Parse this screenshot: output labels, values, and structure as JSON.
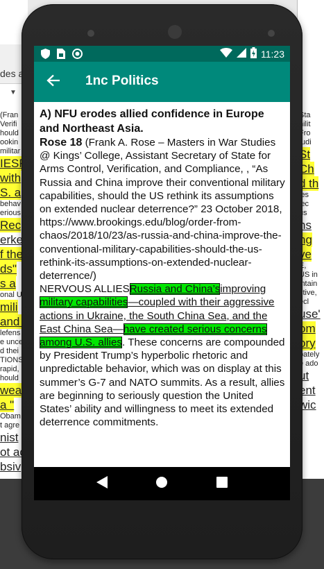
{
  "background_doc": {
    "left_lines": [
      {
        "text": "(Fran",
        "style": "small"
      },
      {
        "text": "Verifi",
        "style": "small"
      },
      {
        "text": "hould",
        "style": "small"
      },
      {
        "text": "ookin",
        "style": "small"
      },
      {
        "text": "militar",
        "style": "small"
      },
      {
        "text": "IESRu",
        "style": "big-hl"
      },
      {
        "text": "with",
        "style": "big-hl"
      },
      {
        "text": "S. a",
        "style": "big-hl"
      },
      {
        "text": "behav",
        "style": "small"
      },
      {
        "text": "erious",
        "style": "small"
      },
      {
        "text": "Rec",
        "style": "big-hl"
      },
      {
        "text": "erke",
        "style": "big"
      },
      {
        "text": "f the",
        "style": "big-hl"
      },
      {
        "text": "ds\"",
        "style": "big-hl"
      },
      {
        "text": "s a",
        "style": "big-hl"
      },
      {
        "text": "onal U",
        "style": "small"
      },
      {
        "text": "mili",
        "style": "big-hl"
      },
      {
        "text": "and c",
        "style": "big-hl"
      },
      {
        "text": "lefens",
        "style": "small"
      },
      {
        "text": "e unce",
        "style": "small"
      },
      {
        "text": "d thei",
        "style": "small"
      },
      {
        "text": "TIONS",
        "style": "small"
      },
      {
        "text": "rapid,",
        "style": "small"
      },
      {
        "text": "hould",
        "style": "small"
      },
      {
        "text": "weap",
        "style": "big-hl"
      },
      {
        "text": "a \"",
        "style": "big-hl"
      },
      {
        "text": "Obam",
        "style": "small"
      },
      {
        "text": "t agre",
        "style": "small"
      },
      {
        "text": "nist",
        "style": "big"
      },
      {
        "text": "ot ac",
        "style": "big"
      },
      {
        "text": "bsiv",
        "style": "big"
      }
    ],
    "toolbar_text": "des a",
    "right_lines": [
      {
        "text": "Sta",
        "style": "small"
      },
      {
        "text": "hilit",
        "style": "small"
      },
      {
        "text": "Fro",
        "style": "small"
      },
      {
        "text": "tudi",
        "style": "small"
      },
      {
        "text": "St",
        "style": "big-hl"
      },
      {
        "text": "Ch",
        "style": "big-hl"
      },
      {
        "text": "d th",
        "style": "big-hl"
      },
      {
        "text": "ies",
        "style": "small"
      },
      {
        "text": "iec",
        "style": "small"
      },
      {
        "text": "us",
        "style": "small"
      },
      {
        "text": "ns",
        "style": "big"
      },
      {
        "text": "ng",
        "style": "big-hl"
      },
      {
        "text": "ve",
        "style": "big-hl"
      },
      {
        "text": "E,",
        "style": "small"
      },
      {
        "text": "US in",
        "style": "small"
      },
      {
        "text": "intain",
        "style": "small"
      },
      {
        "text": "ctive,",
        "style": "small"
      },
      {
        "text": "ecl",
        "style": "small"
      },
      {
        "text": "use'",
        "style": "big"
      },
      {
        "text": "om",
        "style": "big-hl"
      },
      {
        "text": "ory",
        "style": "big-hl"
      },
      {
        "text": "bately",
        "style": "small"
      },
      {
        "text": "e ado",
        "style": "small"
      },
      {
        "text": "ut",
        "style": "big"
      },
      {
        "text": "ent",
        "style": "big"
      },
      {
        "text": "wic",
        "style": "big"
      }
    ]
  },
  "status_bar": {
    "time": "11:23",
    "left_icons": [
      "shield-icon",
      "sim-card-icon",
      "circle-icon"
    ],
    "right_icons": [
      "wifi-icon",
      "signal-icon",
      "battery-icon"
    ]
  },
  "app_bar": {
    "title": "1nc Politics",
    "back_icon": "arrow-back-icon"
  },
  "card": {
    "heading": "A) NFU erodes allied confidence in Europe and Northeast Asia.",
    "cite_author": "Rose 18",
    "cite_body": " (Frank A. Rose – Masters in War Studies @ Kings’ College, Assistant Secretary of State for Arms Control, Verification, and Compliance, , “As Russia and China improve their conventional military capabilities, should the US rethink its assumptions on extended nuclear deterrence?” 23 October 2018, https://www.brookings.edu/blog/order-from-chaos/2018/10/23/as-russia-and-china-improve-the-conventional-military-capabilities-should-the-us-rethink-its-assumptions-on-extended-nuclear-deterrence/)",
    "body_prefix": "NERVOUS ALLIES",
    "hl_1": "Russia and China’s",
    "ul_1": "improving ",
    "hl_2": "military capabilities",
    "ul_2": "—coupled with their aggressive actions in Ukraine, the South China Sea, and the East China Sea—",
    "hl_3": "have created serious concerns among U.S. allies",
    "body_rest": ". These concerns are compounded by President Trump’s hyperbolic rhetoric and unpredictable behavior, which was on display at this summer’s G-7 and NATO summits. As a result, allies are beginning to seriously question the United States’ ability and willingness to meet its extended deterrence commitments."
  },
  "nav_bar": {
    "icons": [
      "back-triangle-icon",
      "home-circle-icon",
      "recents-square-icon"
    ]
  },
  "colors": {
    "status_bar": "#00695c",
    "app_bar": "#00897b",
    "highlight_green": "#00e600",
    "highlight_yellow": "#ffff33"
  }
}
